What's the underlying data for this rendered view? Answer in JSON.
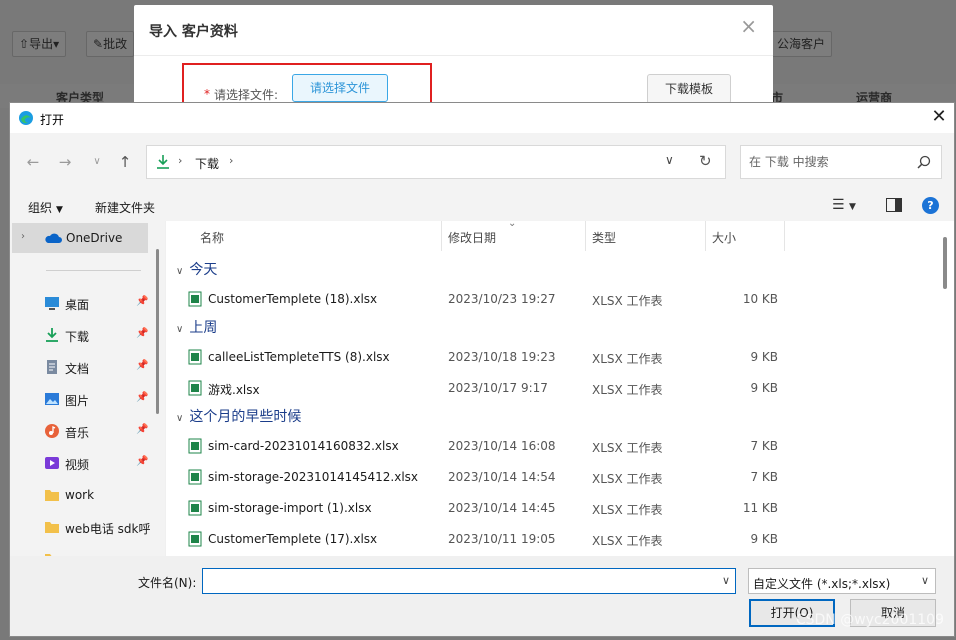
{
  "background": {
    "toolbar": [
      "导出",
      "批改",
      "公海客户"
    ],
    "columns": [
      "客户类型",
      "市",
      "运营商"
    ]
  },
  "import_modal": {
    "title": "导入 客户资料",
    "file_label_star": "*",
    "file_label": "请选择文件:",
    "choose_file_button": "请选择文件",
    "download_template_button": "下载模板"
  },
  "dialog": {
    "title": "打开",
    "address": {
      "path_separator": "›",
      "current_folder": "下载",
      "search_placeholder": "在 下载 中搜索"
    },
    "toolbar": {
      "organize": "组织",
      "new_folder": "新建文件夹"
    },
    "nav": {
      "onedrive": "OneDrive",
      "items": [
        {
          "label": "桌面",
          "icon": "desktop-icon",
          "pinned": true
        },
        {
          "label": "下载",
          "icon": "download-icon",
          "pinned": true
        },
        {
          "label": "文档",
          "icon": "document-icon",
          "pinned": true
        },
        {
          "label": "图片",
          "icon": "pictures-icon",
          "pinned": true
        },
        {
          "label": "音乐",
          "icon": "music-icon",
          "pinned": true
        },
        {
          "label": "视频",
          "icon": "video-icon",
          "pinned": true
        },
        {
          "label": "work",
          "icon": "folder-icon",
          "pinned": false
        },
        {
          "label": "web电话 sdk呼",
          "icon": "folder-icon",
          "pinned": false
        }
      ]
    },
    "columns": {
      "name": "名称",
      "date": "修改日期",
      "type": "类型",
      "size": "大小"
    },
    "groups": [
      {
        "label": "今天",
        "files": [
          {
            "name": "CustomerTemplete (18).xlsx",
            "date": "2023/10/23 19:27",
            "type": "XLSX 工作表",
            "size": "10 KB"
          }
        ]
      },
      {
        "label": "上周",
        "files": [
          {
            "name": "calleeListTempleteTTS (8).xlsx",
            "date": "2023/10/18 19:23",
            "type": "XLSX 工作表",
            "size": "9 KB"
          },
          {
            "name": "游戏.xlsx",
            "date": "2023/10/17 9:17",
            "type": "XLSX 工作表",
            "size": "9 KB"
          }
        ]
      },
      {
        "label": "这个月的早些时候",
        "files": [
          {
            "name": "sim-card-20231014160832.xlsx",
            "date": "2023/10/14 16:08",
            "type": "XLSX 工作表",
            "size": "7 KB"
          },
          {
            "name": "sim-storage-20231014145412.xlsx",
            "date": "2023/10/14 14:54",
            "type": "XLSX 工作表",
            "size": "7 KB"
          },
          {
            "name": "sim-storage-import (1).xlsx",
            "date": "2023/10/14 14:45",
            "type": "XLSX 工作表",
            "size": "11 KB"
          },
          {
            "name": "CustomerTemplete (17).xlsx",
            "date": "2023/10/11 19:05",
            "type": "XLSX 工作表",
            "size": "9 KB"
          }
        ]
      }
    ],
    "bottom": {
      "filename_label": "文件名(N):",
      "filename_value": "",
      "filetype": "自定义文件 (*.xls;*.xlsx)",
      "open_button": "打开(O)",
      "cancel_button": "取消"
    }
  },
  "watermark": "CSDN @wyc2001109",
  "colors": {
    "accent": "#0067c0",
    "excel": "#1e8449",
    "highlight_box": "#e02020",
    "link_blue": "#2d95d8"
  }
}
